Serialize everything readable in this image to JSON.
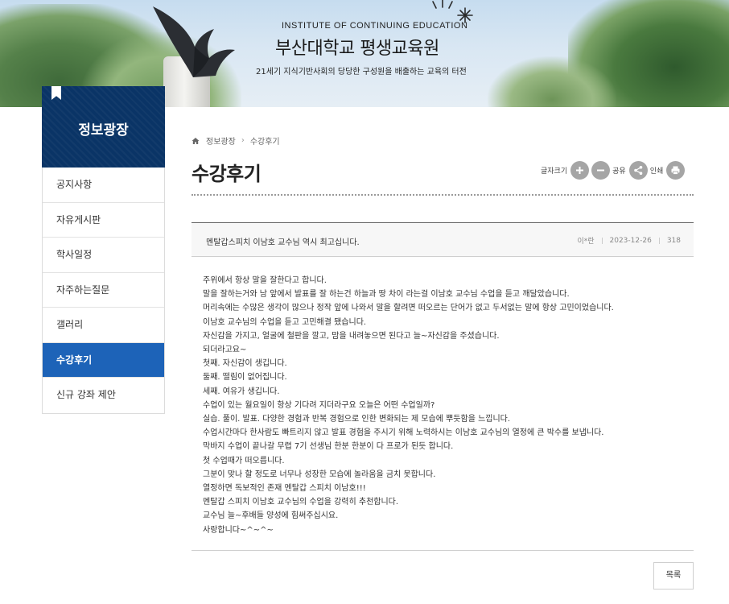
{
  "header": {
    "institute_en": "INSTITUTE OF CONTINUING EDUCATION",
    "institute_ko": "부산대학교 평생교육원",
    "tagline": "21세기 지식기반사회의 당당한 구성원을 배출하는 교육의 터전"
  },
  "sidebar": {
    "title": "정보광장",
    "items": [
      {
        "label": "공지사항"
      },
      {
        "label": "자유게시판"
      },
      {
        "label": "학사일정"
      },
      {
        "label": "자주하는질문"
      },
      {
        "label": "갤러리"
      },
      {
        "label": "수강후기",
        "active": true
      },
      {
        "label": "신규 강좌 제안"
      }
    ]
  },
  "breadcrumb": {
    "items": [
      "정보광장",
      "수강후기"
    ]
  },
  "page": {
    "title": "수강후기"
  },
  "tools": {
    "font_size_label": "글자크기",
    "share_label": "공유",
    "print_label": "인쇄"
  },
  "post": {
    "title": "멘탈갑스피치 이남호 교수님 역시 최고십니다.",
    "author": "이*란",
    "date": "2023-12-26",
    "views": "318",
    "lines": [
      "주위에서 항상  말을 잘한다고 합니다.",
      "말을 잘하는거와 남 앞에서 발표를 잘 하는건 하늘과 땅 차이 라는걸 이남호 교수님 수업을 듣고 깨달았습니다.",
      "머리속에는 수많은 생각이 많으나 정작 앞에 나와서 말을 할려면 떠오르는 단어가 없고 두서없는 말에 항상 고민이었습니다.",
      "이남호 교수님의 수업을 듣고 고민해결 됐습니다.",
      "자신감을 가지고, 얼굴에 철판을 깔고,  맘을 내려놓으면 된다고 늘~자신감을 주셨습니다.",
      "되더라고요~",
      "첫째. 자신감이 생깁니다.",
      "둘째. 떨림이 없어집니다.",
      "세째. 여유가 생깁니다.",
      "수업이 있는 월요일이 항상 기다려 지더라구요 오늘은 어떤 수업일까?",
      "실습. 풀이. 발표. 다양한 경험과 반복 경험으로 인한 변화되는 제 모습에 뿌듯함을 느낍니다.",
      "수업시간마다 한사람도 빠트리지 않고 발표 경험을  주시기 위해 노력하시는 이남호 교수님의 열정에 큰 박수를 보냅니다.",
      "막바지 수업이 끝나갈 무렵 7기 선생님 한분 한분이 다 프로가 된듯 합니다.",
      "첫 수업때가 떠오릅니다.",
      "그분이 맞나 할 정도로 너무나 성장한 모습에 놀라움을 금치 못합니다.",
      "열정하면 독보적인 존재 멘탈갑 스피치 이남호!!!",
      "멘탈갑 스피치 이남호 교수님의 수업을 강력히 추천합니다.",
      "교수님 늘~후배들 양성에 힘써주십시요.",
      "사랑합니다~^~^~"
    ]
  },
  "actions": {
    "list_label": "목록"
  }
}
